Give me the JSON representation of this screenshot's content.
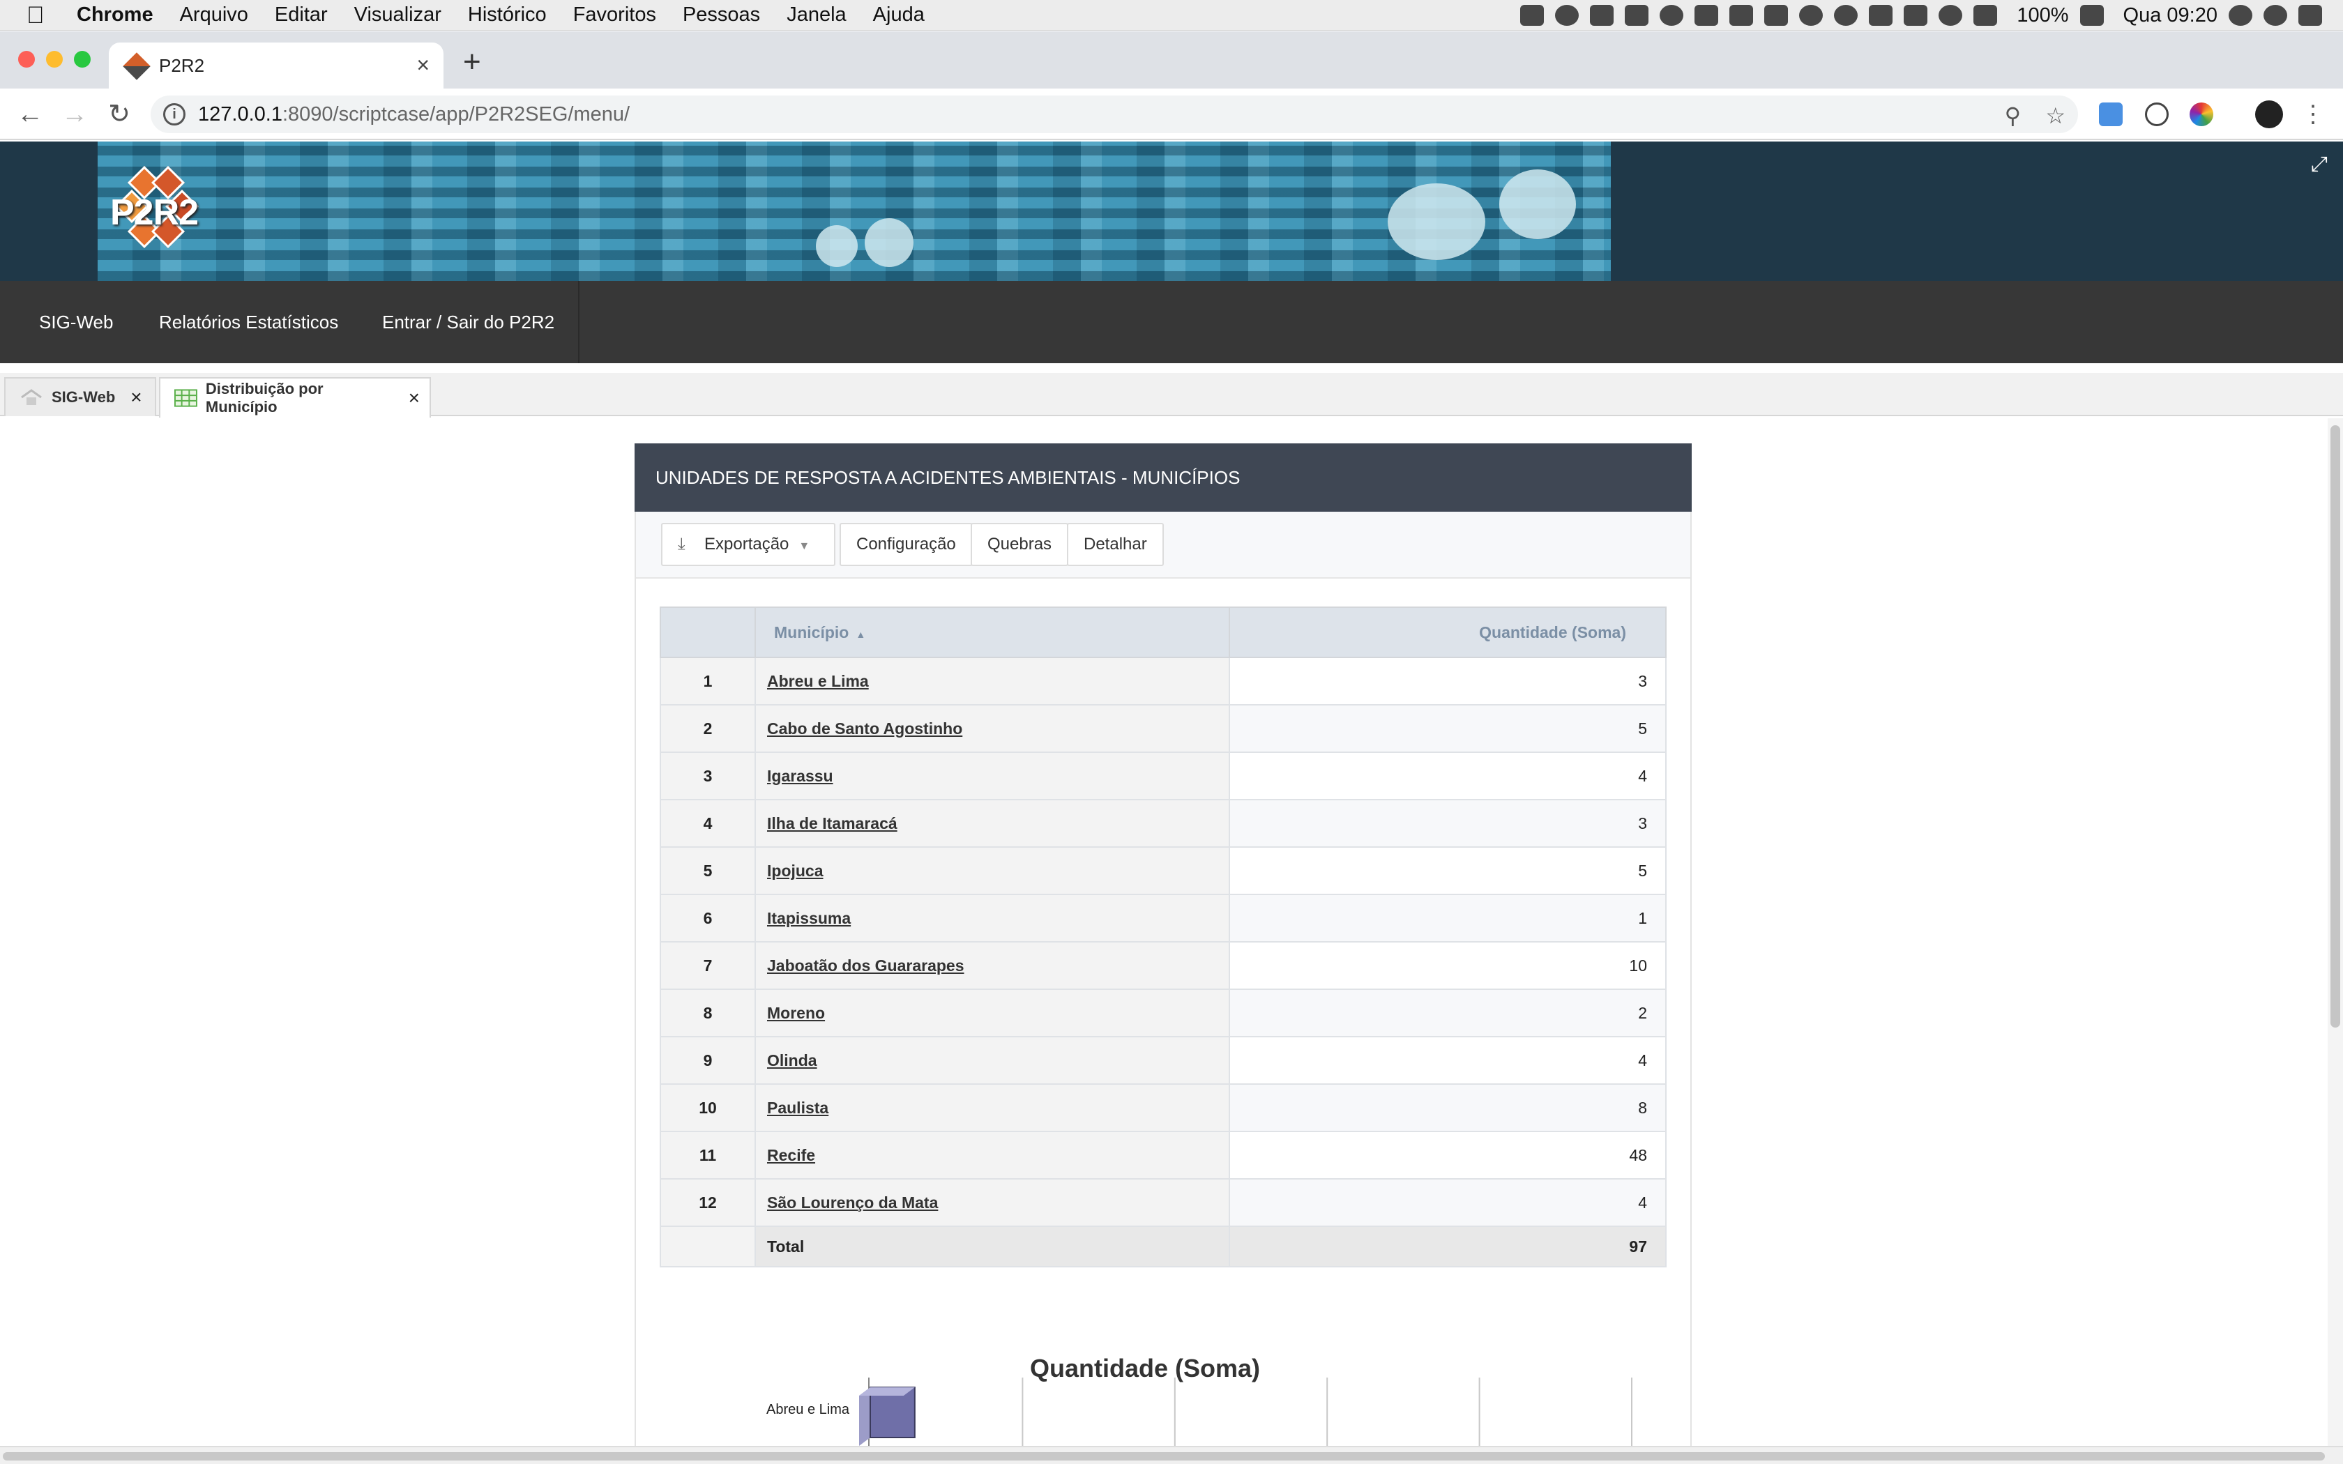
{
  "menubar": {
    "app_name": "Chrome",
    "items": [
      "Arquivo",
      "Editar",
      "Visualizar",
      "Histórico",
      "Favoritos",
      "Pessoas",
      "Janela",
      "Ajuda"
    ],
    "battery": "100%",
    "clock": "Qua 09:20"
  },
  "browser": {
    "tab_title": "P2R2",
    "url_host": "127.0.0.1",
    "url_rest": ":8090/scriptcase/app/P2R2SEG/menu/"
  },
  "app": {
    "logo_text": "P2R2",
    "nav": [
      "SIG-Web",
      "Relatórios Estatísticos",
      "Entrar / Sair do P2R2"
    ],
    "tabs": [
      {
        "label": "SIG-Web",
        "icon": "home-icon"
      },
      {
        "label": "Distribuição por Município",
        "icon": "grid-icon"
      }
    ]
  },
  "report": {
    "title": "UNIDADES DE RESPOSTA A ACIDENTES AMBIENTAIS - MUNICÍPIOS",
    "buttons": {
      "export": "Exportação",
      "config": "Configuração",
      "breaks": "Quebras",
      "detail": "Detalhar"
    },
    "columns": {
      "municipio": "Município",
      "quantidade": "Quantidade (Soma)"
    },
    "rows": [
      {
        "n": "1",
        "municipio": "Abreu e Lima",
        "qtd": "3"
      },
      {
        "n": "2",
        "municipio": "Cabo de Santo Agostinho",
        "qtd": "5"
      },
      {
        "n": "3",
        "municipio": "Igarassu",
        "qtd": "4"
      },
      {
        "n": "4",
        "municipio": "Ilha de Itamaracá",
        "qtd": "3"
      },
      {
        "n": "5",
        "municipio": "Ipojuca",
        "qtd": "5"
      },
      {
        "n": "6",
        "municipio": "Itapissuma",
        "qtd": "1"
      },
      {
        "n": "7",
        "municipio": "Jaboatão dos Guararapes",
        "qtd": "10"
      },
      {
        "n": "8",
        "municipio": "Moreno",
        "qtd": "2"
      },
      {
        "n": "9",
        "municipio": "Olinda",
        "qtd": "4"
      },
      {
        "n": "10",
        "municipio": "Paulista",
        "qtd": "8"
      },
      {
        "n": "11",
        "municipio": "Recife",
        "qtd": "48"
      },
      {
        "n": "12",
        "municipio": "São Lourenço da Mata",
        "qtd": "4"
      }
    ],
    "total_label": "Total",
    "total_value": "97"
  },
  "chart_data": {
    "type": "bar",
    "title": "Quantidade (Soma)",
    "categories": [
      "Abreu e Lima"
    ],
    "values": [
      3
    ],
    "orientation": "horizontal",
    "grid": true
  }
}
